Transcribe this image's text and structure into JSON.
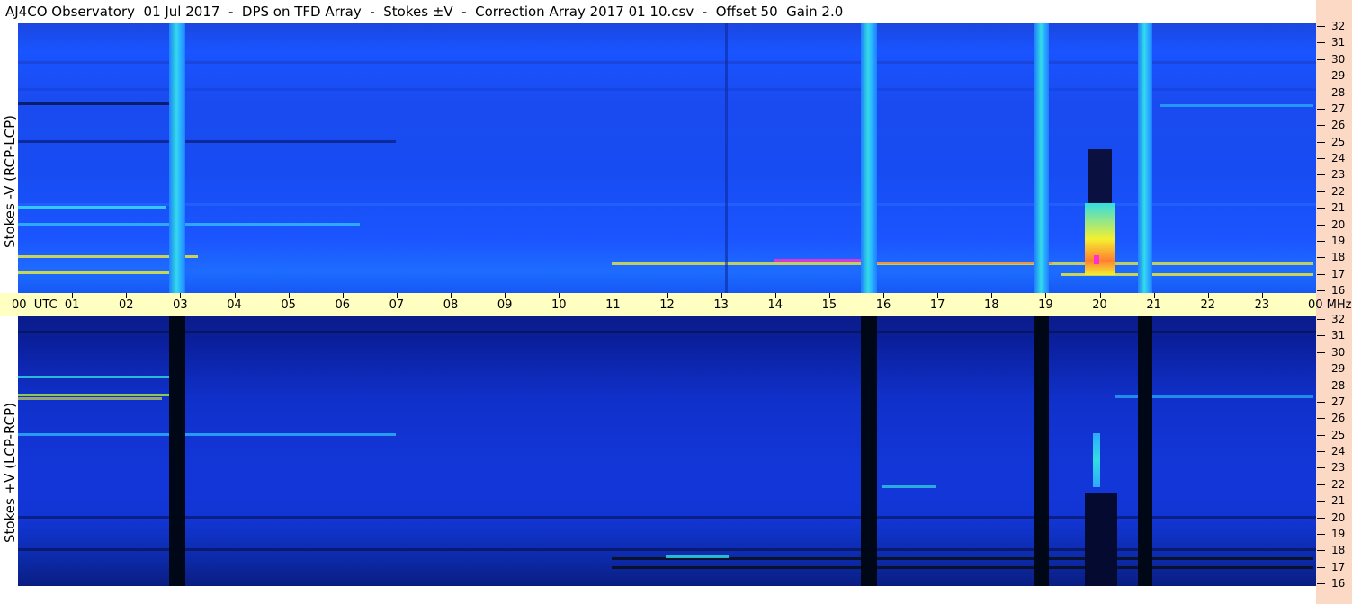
{
  "title": "AJ4CO Observatory  01 Jul 2017  -  DPS on TFD Array  -  Stokes ±V  -  Correction Array 2017 01 10.csv  -  Offset 50  Gain 2.0",
  "panels": {
    "top_label": "Stokes -V (RCP-LCP)",
    "bottom_label": "Stokes +V (LCP-RCP)"
  },
  "time_axis": {
    "left_label": "00  UTC",
    "right_label": "00 MHz",
    "hours": [
      "01",
      "02",
      "03",
      "04",
      "05",
      "06",
      "07",
      "08",
      "09",
      "10",
      "11",
      "12",
      "13",
      "14",
      "15",
      "16",
      "17",
      "18",
      "19",
      "20",
      "21",
      "22",
      "23"
    ]
  },
  "freq_axis": {
    "unit": "MHz",
    "labels": [
      "32",
      "31",
      "30",
      "29",
      "28",
      "27",
      "26",
      "25",
      "24",
      "23",
      "22",
      "21",
      "20",
      "19",
      "18",
      "17",
      "16"
    ]
  },
  "colors": {
    "axis_background": "#ffffc2",
    "scale_background": "#fbd9c5",
    "top_panel_blue": "#1954ff",
    "bottom_panel_blue": "#1236d6",
    "burst_yellow": "#f4f030",
    "burst_magenta": "#ff30d0"
  }
}
